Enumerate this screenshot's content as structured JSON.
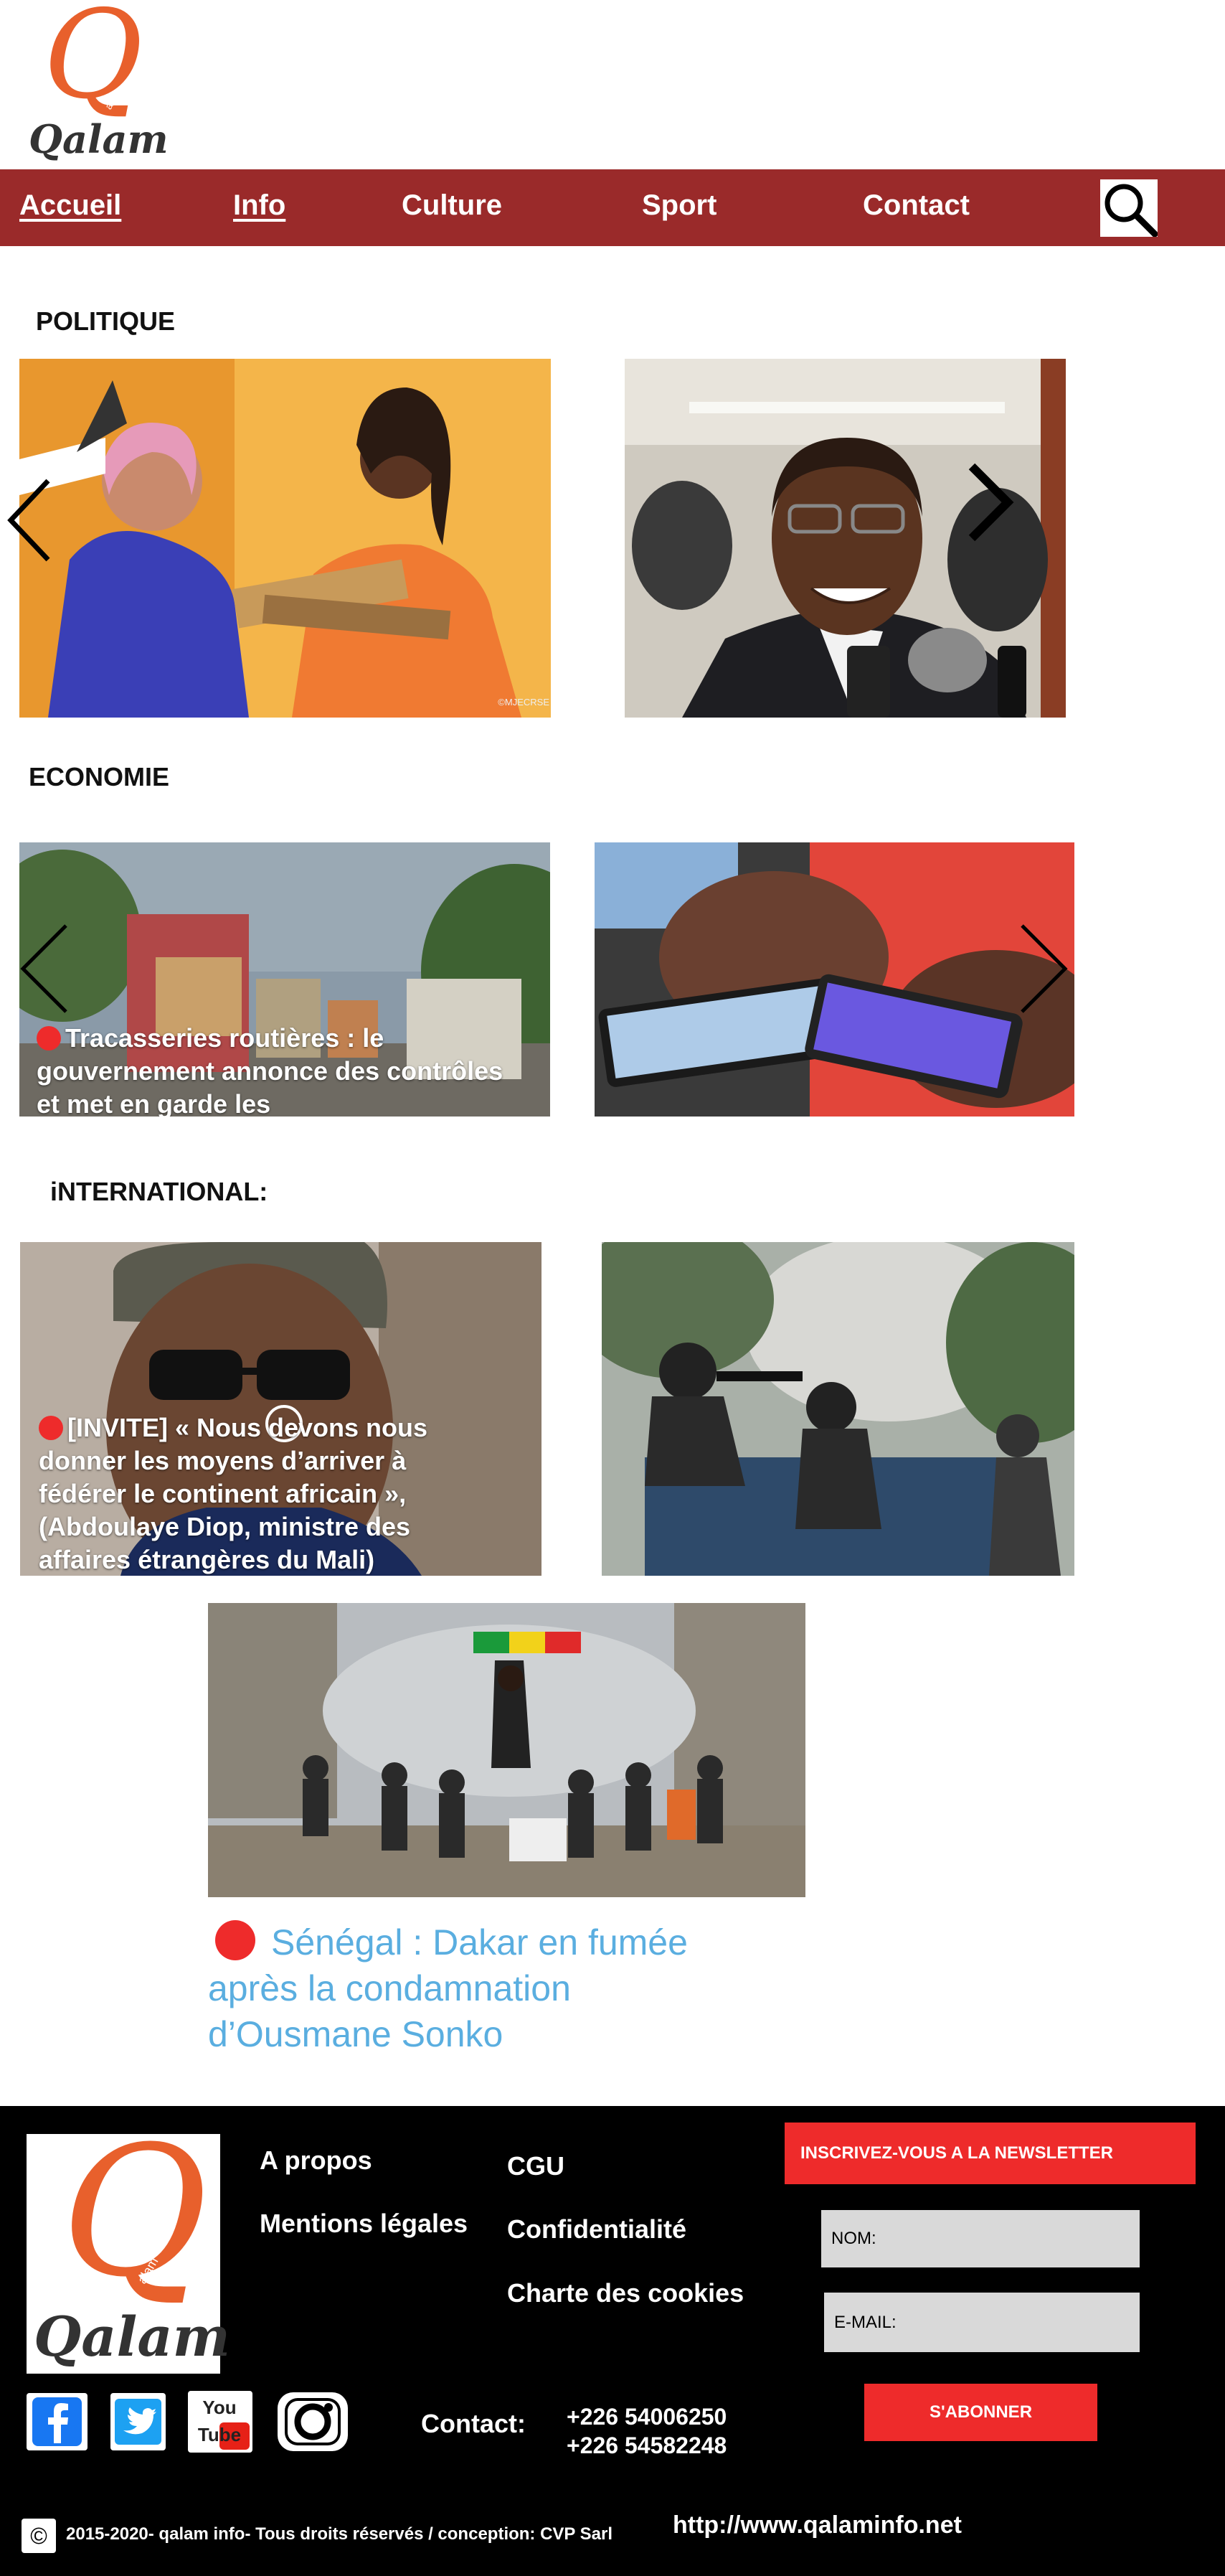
{
  "brand": {
    "logo_letter": "Q",
    "logo_small": "alam",
    "logo_text": "Qalam"
  },
  "nav": {
    "items": [
      {
        "label": "Accueil"
      },
      {
        "label": "Info"
      },
      {
        "label": "Culture"
      },
      {
        "label": "Sport"
      },
      {
        "label": "Contact"
      }
    ],
    "search_icon": "search-icon"
  },
  "sections": {
    "politique": {
      "title": "POLITIQUE",
      "credit": "©MJECRSE"
    },
    "economie": {
      "title": "ECONOMIE",
      "caption": "Tracasseries routières : le gouvernement annonce des contrôles et met en garde les"
    },
    "international": {
      "title": "iNTERNATIONAL:",
      "caption": "[INVITE] « Nous devons nous donner les moyens d’arriver à fédérer le continent africain », (Abdoulaye Diop, ministre des affaires étrangères du Mali)"
    }
  },
  "feature": {
    "headline": "Sénégal : Dakar en fumée après la condamnation d’Ousmane Sonko"
  },
  "footer": {
    "links_col1": [
      "A propos",
      "Mentions légales"
    ],
    "links_col2": [
      "CGU",
      "Confidentialité",
      "Charte des cookies"
    ],
    "newsletter_title": "INSCRIVEZ-VOUS A LA NEWSLETTER",
    "name_placeholder": "NOM:",
    "email_placeholder": "E-MAIL:",
    "subscribe_label": "S'ABONNER",
    "contact_label": "Contact:",
    "phones": [
      "+226 54006250",
      "+226 54582248"
    ],
    "copyright_symbol": "©",
    "copyright": "2015-2020- qalam info- Tous droits réservés / conception: CVP Sarl",
    "website": "http://www.qalaminfo.net",
    "youtube_text": "You Tube",
    "social_icons": [
      "facebook-icon",
      "twitter-icon",
      "youtube-icon",
      "instagram-icon"
    ]
  },
  "colors": {
    "nav_bg": "#9a2a2a",
    "accent_red": "#ee2b2b",
    "headline_blue": "#5aaee0",
    "logo_orange": "#e8602c"
  }
}
